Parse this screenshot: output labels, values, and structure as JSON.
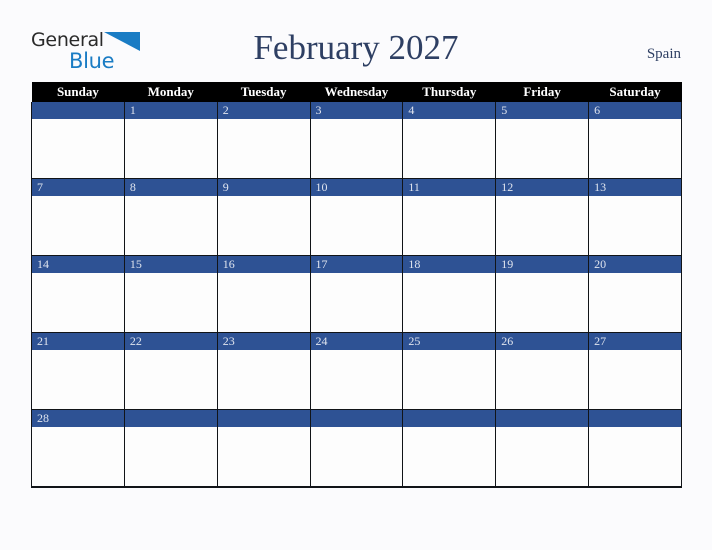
{
  "logo": {
    "word1": "General",
    "word2": "Blue",
    "triangle_color": "#1a7cc4",
    "word1_color": "#2a2a2a",
    "word2_color": "#1a7cc4"
  },
  "header": {
    "title": "February 2027",
    "country": "Spain",
    "title_color": "#2e3f63"
  },
  "calendar": {
    "month": "February",
    "year": "2027",
    "weekday_headers": [
      "Sunday",
      "Monday",
      "Tuesday",
      "Wednesday",
      "Thursday",
      "Friday",
      "Saturday"
    ],
    "header_bg": "#000000",
    "header_text_color": "#ffffff",
    "daynum_band_color": "#2e5294",
    "daynum_text_color": "#dfe4ee",
    "cell_bg": "#fdfdfd",
    "border_color": "#111418",
    "weeks": [
      [
        "",
        "1",
        "2",
        "3",
        "4",
        "5",
        "6"
      ],
      [
        "7",
        "8",
        "9",
        "10",
        "11",
        "12",
        "13"
      ],
      [
        "14",
        "15",
        "16",
        "17",
        "18",
        "19",
        "20"
      ],
      [
        "21",
        "22",
        "23",
        "24",
        "25",
        "26",
        "27"
      ],
      [
        "28",
        "",
        "",
        "",
        "",
        "",
        ""
      ]
    ]
  },
  "page": {
    "background": "#fbfbfd"
  }
}
